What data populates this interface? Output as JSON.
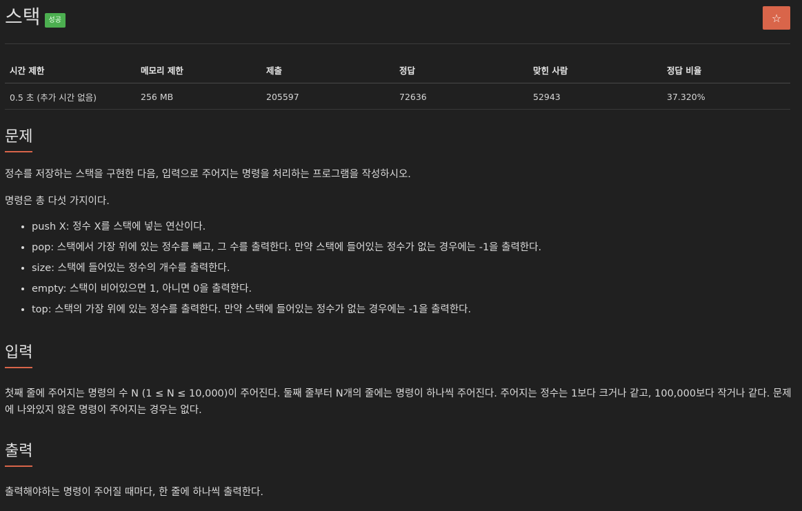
{
  "header": {
    "title": "스택",
    "badge": "성공",
    "star_icon": "star-icon"
  },
  "info_table": {
    "headers": [
      "시간 제한",
      "메모리 제한",
      "제출",
      "정답",
      "맞힌 사람",
      "정답 비율"
    ],
    "values": [
      "0.5 초 (추가 시간 없음)",
      "256 MB",
      "205597",
      "72636",
      "52943",
      "37.320%"
    ]
  },
  "problem": {
    "heading": "문제",
    "p1": "정수를 저장하는 스택을 구현한 다음, 입력으로 주어지는 명령을 처리하는 프로그램을 작성하시오.",
    "p2": "명령은 총 다섯 가지이다.",
    "commands": [
      "push X: 정수 X를 스택에 넣는 연산이다.",
      "pop: 스택에서 가장 위에 있는 정수를 빼고, 그 수를 출력한다. 만약 스택에 들어있는 정수가 없는 경우에는 -1을 출력한다.",
      "size: 스택에 들어있는 정수의 개수를 출력한다.",
      "empty: 스택이 비어있으면 1, 아니면 0을 출력한다.",
      "top: 스택의 가장 위에 있는 정수를 출력한다. 만약 스택에 들어있는 정수가 없는 경우에는 -1을 출력한다."
    ]
  },
  "input": {
    "heading": "입력",
    "text": "첫째 줄에 주어지는 명령의 수 N (1 ≤ N ≤ 10,000)이 주어진다. 둘째 줄부터 N개의 줄에는 명령이 하나씩 주어진다. 주어지는 정수는 1보다 크거나 같고, 100,000보다 작거나 같다. 문제에 나와있지 않은 명령이 주어지는 경우는 없다."
  },
  "output": {
    "heading": "출력",
    "text": "출력해야하는 명령이 주어질 때마다, 한 줄에 하나씩 출력한다."
  },
  "colors": {
    "background": "#202020",
    "accent": "#d9654a",
    "badge": "#4caf50"
  }
}
